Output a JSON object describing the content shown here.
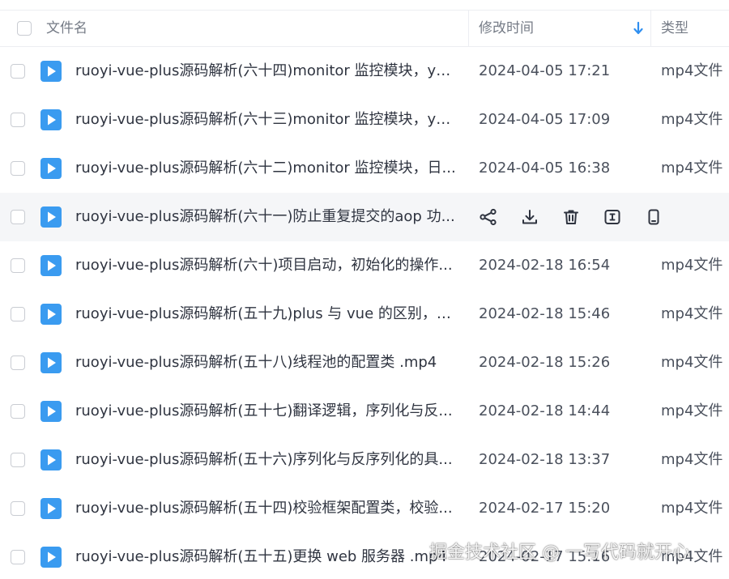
{
  "header": {
    "name_label": "文件名",
    "time_label": "修改时间",
    "type_label": "类型"
  },
  "colors": {
    "icon_blue": "#3a9bf0",
    "sort_blue": "#2f8ff0",
    "hover_row": "#f5f6f8"
  },
  "rows": [
    {
      "name": "ruoyi-vue-plus源码解析(六十四)monitor 监控模块，ym...",
      "time": "2024-04-05 17:21",
      "type": "mp4文件"
    },
    {
      "name": "ruoyi-vue-plus源码解析(六十三)monitor 监控模块，ym...",
      "time": "2024-04-05 17:09",
      "type": "mp4文件"
    },
    {
      "name": "ruoyi-vue-plus源码解析(六十二)monitor 监控模块，日...",
      "time": "2024-04-05 16:38",
      "type": "mp4文件"
    },
    {
      "name": "ruoyi-vue-plus源码解析(六十一)防止重复提交的aop 功...",
      "time": "",
      "type": ""
    },
    {
      "name": "ruoyi-vue-plus源码解析(六十)项目启动，初始化的操作...",
      "time": "2024-02-18 16:54",
      "type": "mp4文件"
    },
    {
      "name": "ruoyi-vue-plus源码解析(五十九)plus 与 vue 的区别，有...",
      "time": "2024-02-18 15:46",
      "type": "mp4文件"
    },
    {
      "name": "ruoyi-vue-plus源码解析(五十八)线程池的配置类 .mp4",
      "time": "2024-02-18 15:26",
      "type": "mp4文件"
    },
    {
      "name": "ruoyi-vue-plus源码解析(五十七)翻译逻辑，序列化与反...",
      "time": "2024-02-18 14:44",
      "type": "mp4文件"
    },
    {
      "name": "ruoyi-vue-plus源码解析(五十六)序列化与反序列化的具...",
      "time": "2024-02-18 13:37",
      "type": "mp4文件"
    },
    {
      "name": "ruoyi-vue-plus源码解析(五十四)校验框架配置类，校验...",
      "time": "2024-02-17 15:20",
      "type": "mp4文件"
    },
    {
      "name": "ruoyi-vue-plus源码解析(五十五)更换  web 服务器 .mp4",
      "time": "2024-02-17 15:16",
      "type": "mp4文件"
    }
  ],
  "hover_actions": [
    "share-icon",
    "download-icon",
    "delete-icon",
    "rename-icon",
    "mobile-icon"
  ],
  "watermark": "掘金技术社区 @ 一写代码就开心"
}
